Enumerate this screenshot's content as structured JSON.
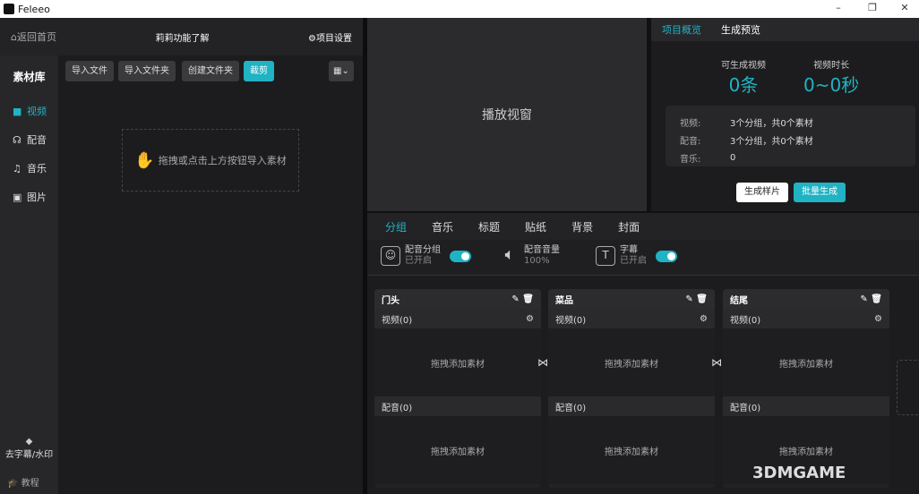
{
  "window": {
    "title": "Feleeo",
    "controls": [
      "minimize-icon",
      "restore-icon",
      "close-icon"
    ]
  },
  "header": {
    "back": "返回首页",
    "project_name": "莉莉功能了解",
    "settings": "项目设置"
  },
  "sidebar": {
    "title": "素材库",
    "items": [
      {
        "label": "视频",
        "icon": "video-icon",
        "active": true
      },
      {
        "label": "配音",
        "icon": "voice-icon"
      },
      {
        "label": "音乐",
        "icon": "music-icon"
      },
      {
        "label": "图片",
        "icon": "image-icon"
      }
    ],
    "watermark": "去字幕/水印",
    "tutorial": "教程"
  },
  "library": {
    "buttons": [
      "导入文件",
      "导入文件夹",
      "创建文件夹",
      "裁剪"
    ],
    "dropzone": "拖拽或点击上方按钮导入素材"
  },
  "player": {
    "label": "播放视窗"
  },
  "overview": {
    "tabs": [
      "项目概览",
      "生成预览"
    ],
    "count_label": "可生成视频",
    "count_value": "0条",
    "duration_label": "视频时长",
    "duration_value": "0~0秒",
    "rows": [
      {
        "k": "视频:",
        "v": "3个分组，共0个素材"
      },
      {
        "k": "配音:",
        "v": "3个分组，共0个素材"
      },
      {
        "k": "音乐:",
        "v": "0"
      }
    ],
    "sample_button": "生成样片",
    "batch_button": "批量生成"
  },
  "editor": {
    "tabs": [
      "分组",
      "音乐",
      "标题",
      "贴纸",
      "背景",
      "封面"
    ],
    "toggles": [
      {
        "title": "配音分组",
        "status": "已开启",
        "on": true
      },
      {
        "title": "配音音量",
        "status": "100%"
      },
      {
        "title": "字幕",
        "status": "已开启",
        "on": true
      }
    ],
    "groups": [
      {
        "name": "门头",
        "video": "视频(0)",
        "audio": "配音(0)",
        "drop": "拖拽添加素材"
      },
      {
        "name": "菜品",
        "video": "视频(0)",
        "audio": "配音(0)",
        "drop": "拖拽添加素材"
      },
      {
        "name": "结尾",
        "video": "视频(0)",
        "audio": "配音(0)",
        "drop": "拖拽添加素材"
      }
    ]
  },
  "colors": {
    "accent": "#1fb3c4",
    "background": "#1c1c1e"
  },
  "watermark_logo": "3DMGAME"
}
